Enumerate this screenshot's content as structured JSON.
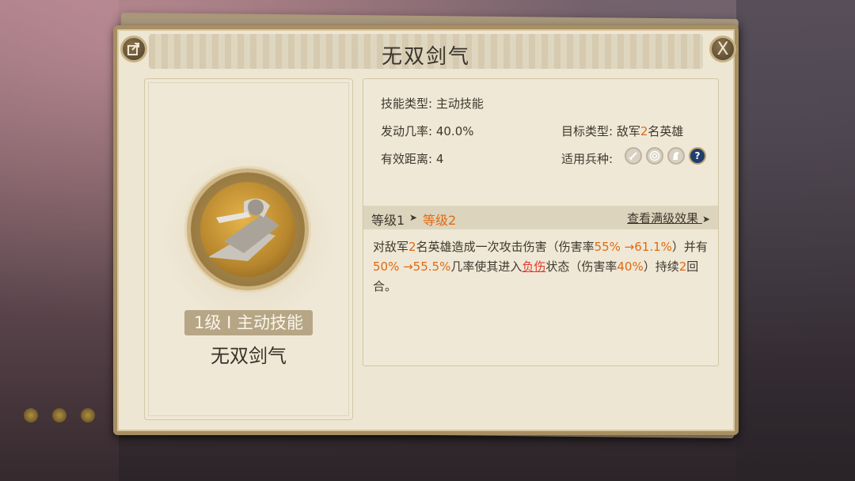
{
  "window": {
    "title": "无双剑气",
    "share_icon": "share-icon",
    "close_label": "X"
  },
  "skill": {
    "badge": "1级 I 主动技能",
    "name": "无双剑气"
  },
  "info": {
    "type_label": "技能类型:",
    "type_value": "主动技能",
    "rate_label": "发动几率:",
    "rate_value": "40.0%",
    "target_label": "目标类型:",
    "target_prefix": "敌军",
    "target_count": "2",
    "target_suffix": "名英雄",
    "range_label": "有效距离:",
    "range_value": "4",
    "troop_label": "适用兵种:",
    "troop_icons": [
      "sword-icon",
      "archery-target-icon",
      "horse-icon",
      "question-icon"
    ]
  },
  "level": {
    "from": "等级1",
    "arrow": "➤",
    "to": "等级2",
    "view_max": "查看满级效果",
    "view_max_arrow": "➤"
  },
  "description": {
    "p1": "对敌军",
    "n1": "2",
    "p2": "名英雄造成一次攻击伤害（伤害率",
    "v1": "55% →61.1%",
    "p3": "）并有",
    "v2": "50% →55.5%",
    "p4": "几率使其进入",
    "debuff": "负伤",
    "p5": "状态（伤害率",
    "v3": "40%",
    "p6": "）持续",
    "n2": "2",
    "p7": "回合。"
  },
  "colors": {
    "highlight": "#e06a12",
    "debuff": "#e23a2c",
    "panel": "#ede6d3",
    "frame": "#a88f62"
  }
}
